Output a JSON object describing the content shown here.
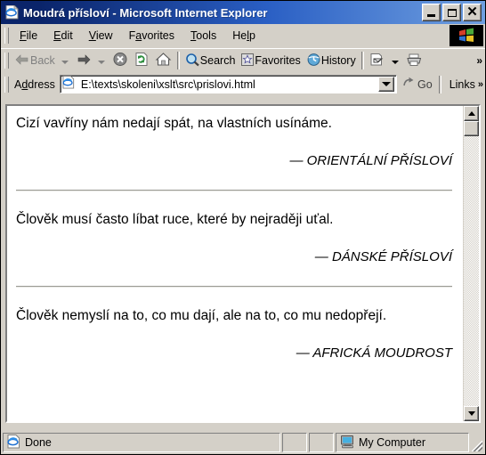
{
  "window": {
    "title": "Moudrá přísloví - Microsoft Internet Explorer",
    "title_icon": "ie-document-icon",
    "minimize_label": "Minimize",
    "maximize_label": "Maximize",
    "close_label": "Close"
  },
  "menu": {
    "items": [
      {
        "label": "File",
        "accel": "F",
        "rest": "ile"
      },
      {
        "label": "Edit",
        "accel": "E",
        "rest": "dit"
      },
      {
        "label": "View",
        "accel": "V",
        "rest": "iew"
      },
      {
        "label": "Favorites",
        "pre": "F",
        "accel": "a",
        "rest": "vorites"
      },
      {
        "label": "Tools",
        "accel": "T",
        "rest": "ools"
      },
      {
        "label": "Help",
        "pre": "He",
        "accel": "l",
        "rest": "p"
      }
    ],
    "logo": "windows-flag-logo"
  },
  "toolbar": {
    "back_label": "Back",
    "forward_label": "",
    "stop_label": "Stop",
    "refresh_label": "Refresh",
    "home_label": "Home",
    "search_label": "Search",
    "favorites_label": "Favorites",
    "history_label": "History",
    "mail_label": "Mail",
    "print_label": "Print",
    "overflow_label": "»"
  },
  "address": {
    "label": "Address",
    "value": "E:\\texts\\skoleni\\xslt\\src\\prislovi.html",
    "placeholder": "",
    "go_label": "Go",
    "links_label": "Links",
    "overflow_label": "»"
  },
  "page": {
    "quotes": [
      {
        "text": "Cizí vavříny nám nedají spát, na vlastních usínáme.",
        "attribution": "— ORIENTÁLNÍ PŘÍSLOVÍ"
      },
      {
        "text": "Člověk musí často líbat ruce, které by nejraději uťal.",
        "attribution": "— DÁNSKÉ PŘÍSLOVÍ"
      },
      {
        "text": "Člověk nemyslí na to, co mu dají, ale na to, co mu nedopřejí.",
        "attribution": "— AFRICKÁ MOUDROST"
      }
    ]
  },
  "statusbar": {
    "status_text": "Done",
    "status_icon": "ie-document-icon",
    "zone_text": "My Computer",
    "zone_icon": "computer-monitor-icon"
  },
  "colors": {
    "title_active_start": "#0a246a",
    "title_active_end": "#6f9fe0",
    "chrome": "#d4d0c8",
    "page_bg": "#ffffff",
    "text": "#000000",
    "disabled_text": "#808080",
    "rule": "#9a9a94"
  }
}
